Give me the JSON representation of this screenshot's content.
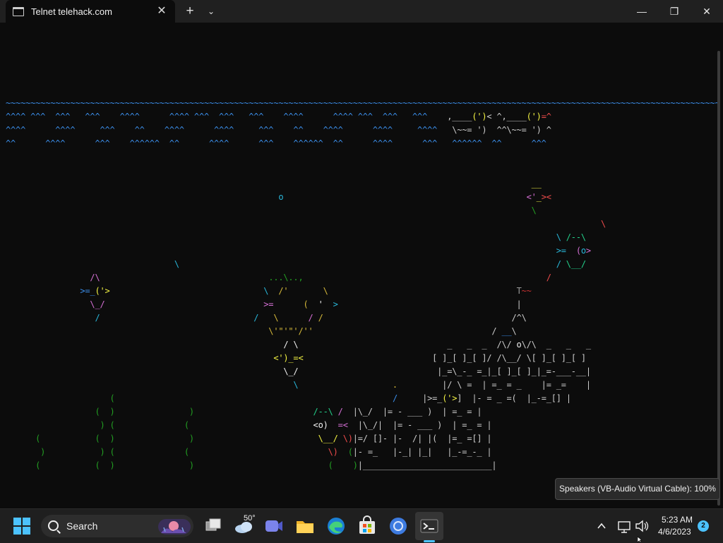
{
  "window": {
    "tab_title": "Telnet telehack.com",
    "tab_close": "✕",
    "new_tab": "+",
    "tab_menu": "⌄",
    "minimize": "—",
    "maximize": "❐",
    "close": "✕"
  },
  "terminal": {
    "aquarium_lines": [
      [
        [
          "w",
          "~~~~~~~~~~~~~~~~~~~~~~~~~~~~~~~~~~~~~~~~~~~~~~~~~~~~~~~~~~~~~~~~~~~~~~~~~~~~~~~~~~~~~~~~~~~~~~~~~~~~~~~~~~~~~~~~~~~~~~~~~~~~~~~~~~~~~~~~~~~~~~~~~~_~~~~~~~~~~_~~~"
        ]
      ],
      [
        [
          "w",
          "^^^^ ^^^  ^^^   ^^^    ^^^^      ^^^^ ^^^  ^^^   ^^^    ^^^^      ^^^^ ^^^  ^^^   ^^^   "
        ],
        [
          "t",
          " ,____"
        ],
        [
          "Y",
          "(')"
        ],
        [
          "t",
          "< ^,____"
        ],
        [
          "Y",
          "(')"
        ],
        [
          "R",
          "=^"
        ]
      ],
      [
        [
          "w",
          "^^^^      ^^^^     ^^^    ^^    ^^^^      ^^^^     ^^^    ^^    ^^^^      ^^^^     ^^^^ "
        ],
        [
          "t",
          "  \\~~= ')  ^^\\~~= ') ^"
        ]
      ],
      [
        [
          "w",
          "^^      ^^^^      ^^^    ^^^^^^  ^^      ^^^^      ^^^    ^^^^^^  ^^      ^^^^      ^^^   ^^^^^^  ^^      ^^^"
        ]
      ],
      [],
      [],
      [
        [
          "Y",
          "                                                                                                          __"
        ]
      ],
      [
        [
          "c",
          "                                                       o                                                 "
        ],
        [
          "M",
          "<'"
        ],
        [
          "Y",
          "_"
        ],
        [
          "R",
          ">< "
        ]
      ],
      [
        [
          "g",
          "                                                                                                          \\"
        ]
      ],
      [
        [
          "R",
          "                                                                                                                        \\"
        ]
      ],
      [
        [
          "c",
          "                                                                                                               \\ "
        ],
        [
          "G",
          "/--\\"
        ]
      ],
      [
        [
          "t",
          "                                                                                                               "
        ],
        [
          "c",
          ">= "
        ],
        [
          "M",
          " ("
        ],
        [
          "c",
          "o"
        ],
        [
          "M",
          ">"
        ]
      ],
      [
        [
          "c",
          "                                  \\                                                                            / "
        ],
        [
          "G",
          "\\__/"
        ]
      ],
      [
        [
          "M",
          "                 /\\                                  "
        ],
        [
          "g",
          "...\\..,"
        ],
        [
          "R",
          "                                                 /"
        ]
      ],
      [
        [
          "w",
          "               >=_"
        ],
        [
          "Y",
          "('>"
        ],
        [
          "c",
          "                               \\  "
        ],
        [
          "y",
          "/'       \\"
        ],
        [
          "t",
          "                                      "
        ],
        [
          "d",
          "T"
        ],
        [
          "r",
          "~~"
        ]
      ],
      [
        [
          "M",
          "                 \\_/                                >= "
        ],
        [
          "y",
          "     (  "
        ],
        [
          "T",
          "'"
        ],
        [
          "c",
          "  >"
        ],
        [
          "t",
          "                                    |"
        ]
      ],
      [
        [
          "c",
          "                  /                               /   "
        ],
        [
          "y",
          "\\      "
        ],
        [
          "M",
          "/ "
        ],
        [
          "y",
          "/"
        ],
        [
          "t",
          "                                      /^\\"
        ]
      ],
      [
        [
          "y",
          "                                                     \\'\"'\"'/''"
        ],
        [
          "t",
          "                                    / "
        ],
        [
          "w",
          "__"
        ],
        [
          "t",
          "\\"
        ]
      ],
      [
        [
          "T",
          "                                                        / \\"
        ],
        [
          "t",
          "                              _   _  _  /\\/ "
        ],
        [
          "T",
          "o"
        ],
        [
          "t",
          "\\/\\  _   _   _"
        ]
      ],
      [
        [
          "Y",
          "                                                      <')_=<"
        ],
        [
          "t",
          "                          [ ]_[ ]_[ ]/ /\\__/ \\[ ]_[ ]_[ ]"
        ]
      ],
      [
        [
          "T",
          "                                                        \\_/"
        ],
        [
          "t",
          "                            |_=\\_-_ =_|_[ ]_[ ]_|_=-___-__|"
        ]
      ],
      [
        [
          "c",
          "                                                          \\"
        ],
        [
          "y",
          "                   ."
        ],
        [
          "t",
          "         |/ \\ =  | =_ = _    |= _=    |"
        ]
      ],
      [
        [
          "g",
          "                     ("
        ],
        [
          "t",
          "                                                        "
        ],
        [
          "w",
          "/"
        ],
        [
          "t",
          "     |>=_"
        ],
        [
          "Y",
          "('>"
        ],
        [
          "t",
          "]  |- = _ =("
        ],
        [
          "g",
          ""
        ],
        [
          "t",
          "  |_-=_[] |"
        ]
      ],
      [
        [
          "g",
          "                  (  )               )"
        ],
        [
          "t",
          "                        "
        ],
        [
          "G",
          "/--\\ "
        ],
        [
          "M",
          "/"
        ],
        [
          "t",
          "  |\\_/  |= - ___ )  | =_ = |"
        ]
      ],
      [
        [
          "g",
          "                   ) (              ("
        ],
        [
          "t",
          "                         "
        ],
        [
          "T",
          "<o)"
        ],
        [
          "M",
          "  =<"
        ],
        [
          "t",
          "  |\\_/|  |= - ___ )  | =_ = |"
        ]
      ],
      [
        [
          "g",
          "      (           (  )               )"
        ],
        [
          "t",
          "                         "
        ],
        [
          "Y",
          "\\__/ "
        ],
        [
          "R",
          "\\)"
        ],
        [
          "t",
          "|=/ []- |-  /| |(  |=_ =[] |"
        ]
      ],
      [
        [
          "g",
          "       )           ) (              ("
        ],
        [
          "t",
          "                            "
        ],
        [
          "R",
          "\\)"
        ],
        [
          "g",
          "  ("
        ],
        [
          "t",
          "|- =_   |-_| |_|   |_-=_-_ |"
        ]
      ],
      [
        [
          "g",
          "      (           (  )               )"
        ],
        [
          "t",
          "                           "
        ],
        [
          "g",
          "(    )"
        ],
        [
          "t",
          "|__________________________|"
        ]
      ]
    ]
  },
  "tooltip": "Speakers (VB-Audio Virtual Cable): 100%",
  "taskbar": {
    "search_label": "Search",
    "weather_temp": "50°",
    "clock_time": "5:23 AM",
    "clock_date": "4/6/2023",
    "notification_count": "2",
    "colors": {
      "accent": "#4cc2ff",
      "taskbar_bg": "#1f1f1f",
      "terminal_bg": "#0c0c0c"
    }
  }
}
